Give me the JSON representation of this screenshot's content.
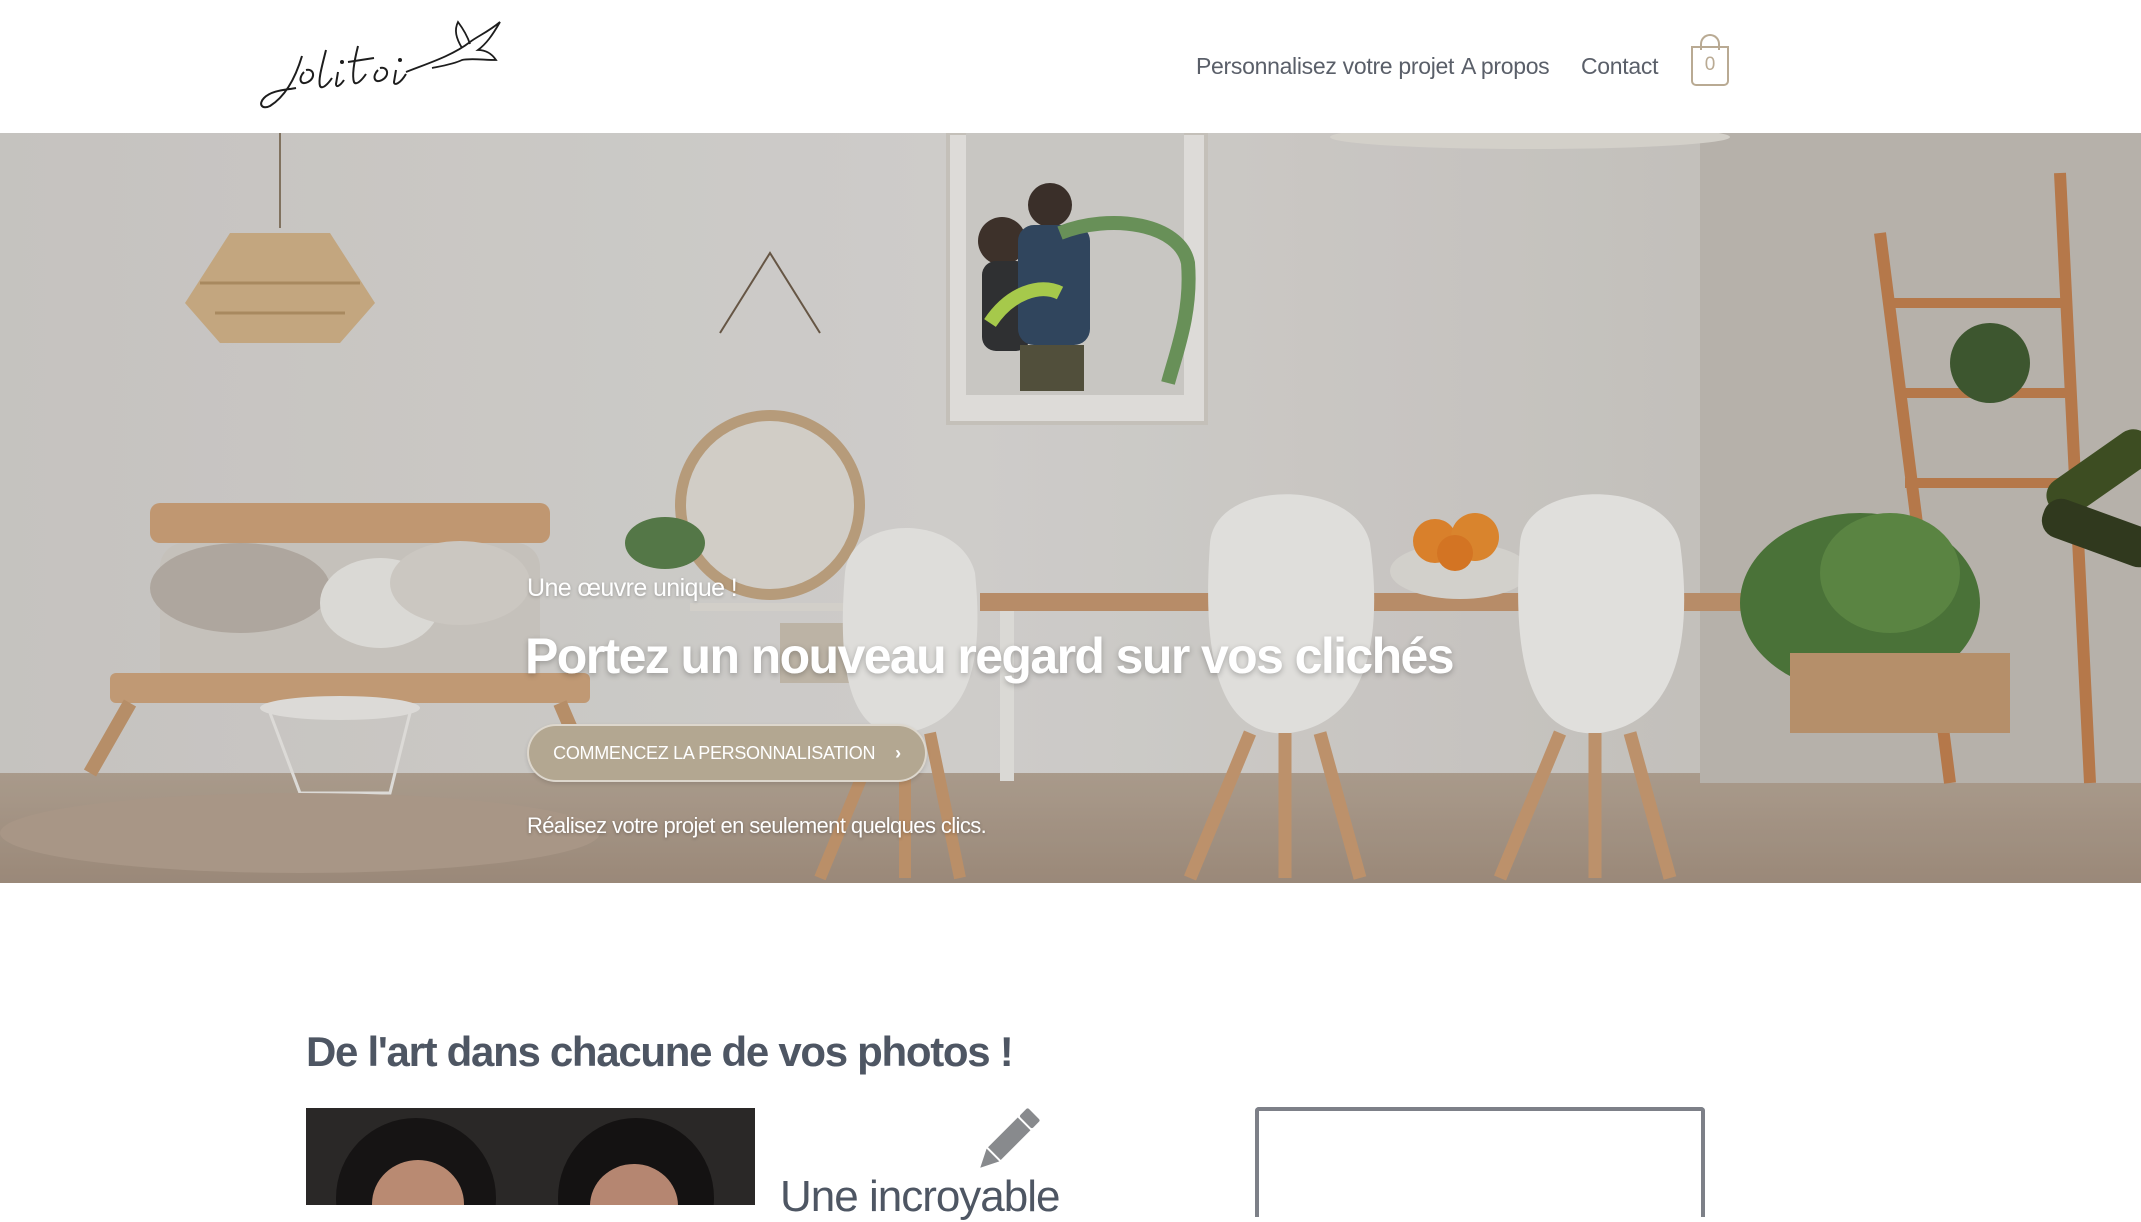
{
  "header": {
    "logo_text": "jolitoi",
    "nav": [
      {
        "label": "Personnalisez votre projet"
      },
      {
        "label": "A propos"
      },
      {
        "label": "Contact"
      }
    ],
    "cart": {
      "count": "0"
    }
  },
  "hero": {
    "kicker": "Une œuvre unique !",
    "title": "Portez un nouveau regard sur vos clichés",
    "cta_label": "COMMENCEZ LA PERSONNALISATION",
    "subtitle": "Réalisez votre projet en seulement quelques clics."
  },
  "section": {
    "title": "De l'art dans chacune de vos photos !",
    "feature_title": "Une incroyable"
  },
  "colors": {
    "accent": "#b3a791",
    "text": "#4e5663",
    "nav_text": "#5a5f69"
  }
}
